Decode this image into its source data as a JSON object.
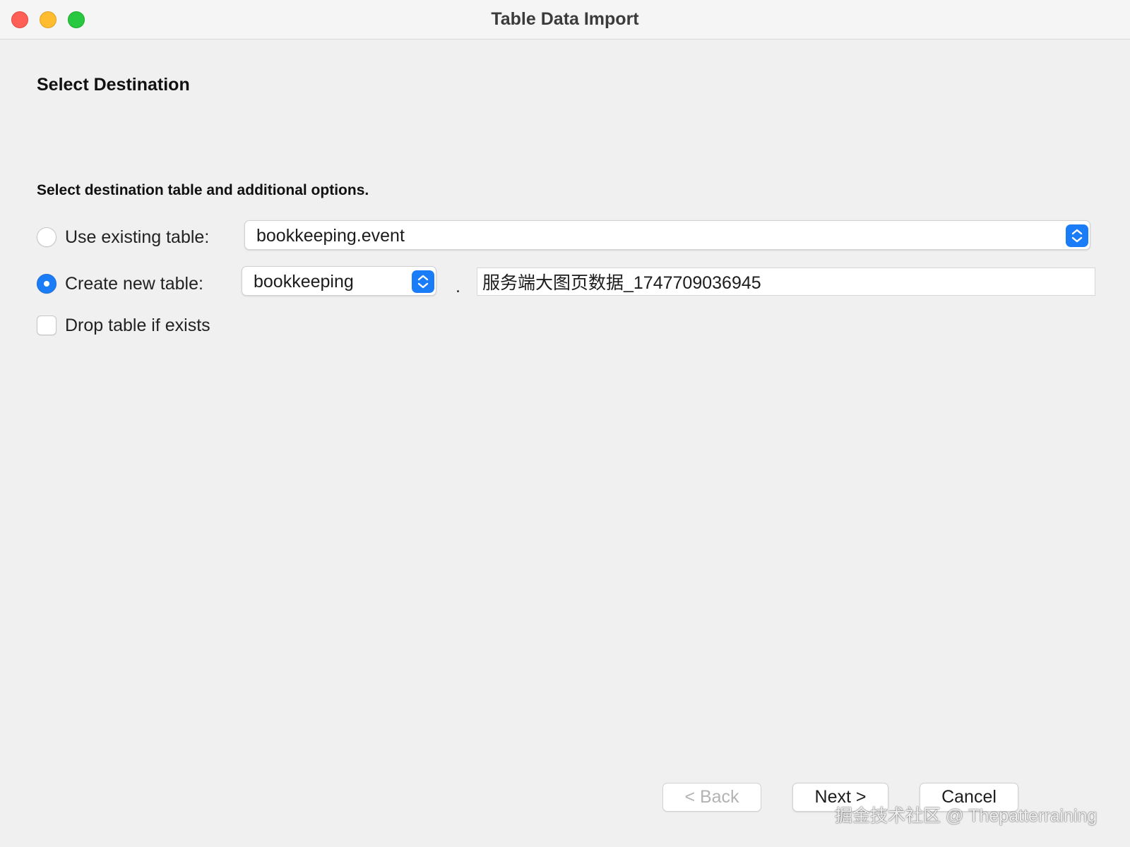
{
  "window": {
    "title": "Table Data Import"
  },
  "page": {
    "heading": "Select Destination",
    "subheading": "Select destination table and additional options."
  },
  "options": {
    "use_existing": {
      "label": "Use existing table:",
      "selected": false,
      "table_value": "bookkeeping.event"
    },
    "create_new": {
      "label": "Create new table:",
      "selected": true,
      "schema_value": "bookkeeping",
      "separator": ".",
      "table_name": "服务端大图页数据_1747709036945"
    },
    "drop_table": {
      "label": "Drop table if exists",
      "checked": false
    }
  },
  "buttons": {
    "back": "< Back",
    "next": "Next >",
    "cancel": "Cancel"
  },
  "watermark": "掘金技术社区 @ Thepatterraining",
  "colors": {
    "accent": "#1a7cf6",
    "traffic_close": "#ff5f57",
    "traffic_minimize": "#febc2e",
    "traffic_zoom": "#28c840"
  }
}
